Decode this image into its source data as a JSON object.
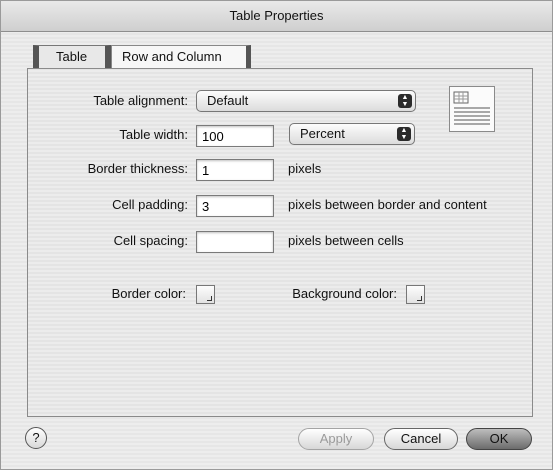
{
  "window": {
    "title": "Table Properties"
  },
  "tabs": [
    {
      "label": "Table",
      "selected": true
    },
    {
      "label": "Row and Column",
      "selected": false
    }
  ],
  "form": {
    "alignment": {
      "label": "Table alignment:",
      "value": "Default"
    },
    "width": {
      "label": "Table width:",
      "value": "100",
      "unit": "Percent"
    },
    "border": {
      "label": "Border thickness:",
      "value": "1",
      "suffix": "pixels"
    },
    "padding": {
      "label": "Cell padding:",
      "value": "3",
      "suffix": "pixels between border and content"
    },
    "spacing": {
      "label": "Cell spacing:",
      "value": "",
      "suffix": "pixels between cells"
    },
    "border_color": {
      "label": "Border color:"
    },
    "background_color": {
      "label": "Background color:"
    }
  },
  "icons": {
    "popup_arrows": "up-down-arrows-icon",
    "preview": "table-layout-preview-icon",
    "help": "help-icon"
  },
  "buttons": {
    "help": "?",
    "apply": "Apply",
    "cancel": "Cancel",
    "ok": "OK"
  },
  "colors": {
    "ok_button": "#8a8a8a",
    "disabled_text": "#9a9a9a"
  }
}
